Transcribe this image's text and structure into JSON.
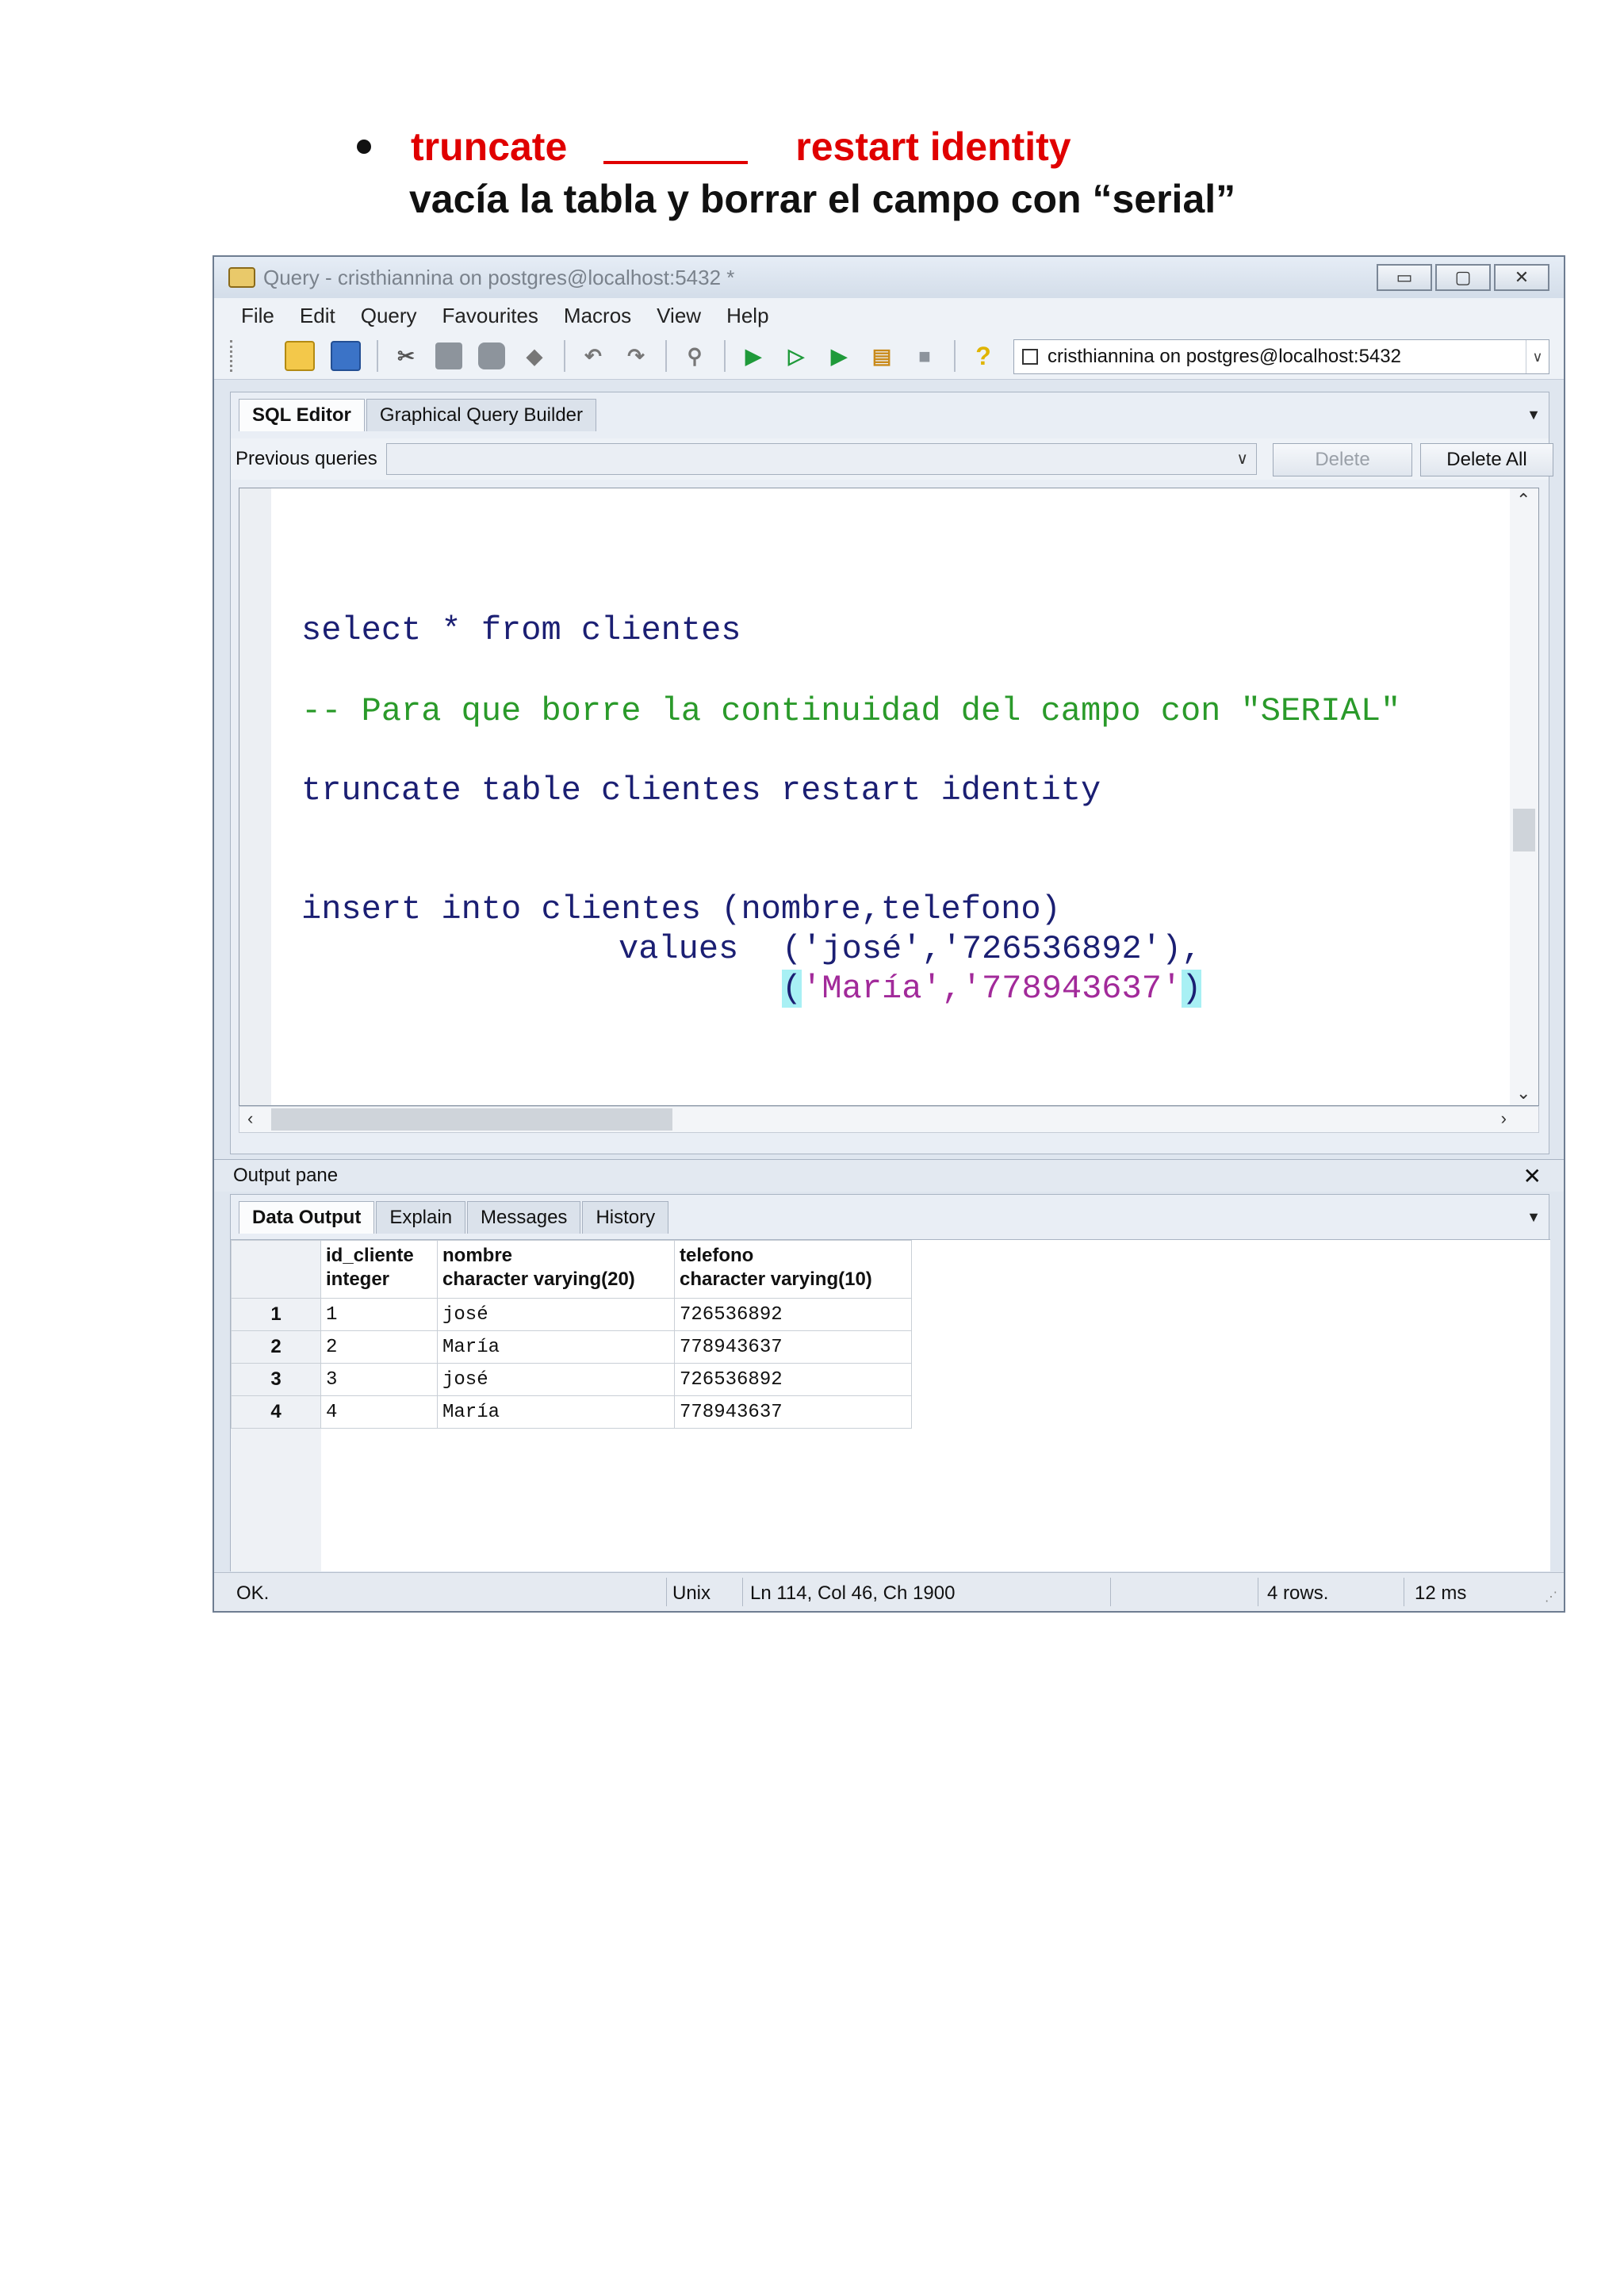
{
  "heading": {
    "keyword1": "truncate",
    "keyword2": "restart identity",
    "description": "vacía la tabla y borrar el campo con “serial”"
  },
  "window": {
    "title": "Query - cristhiannina on postgres@localhost:5432 *",
    "controls": {
      "minimize": "▭",
      "maximize": "▢",
      "close": "✕"
    }
  },
  "menu": [
    "File",
    "Edit",
    "Query",
    "Favourites",
    "Macros",
    "View",
    "Help"
  ],
  "toolbar": {
    "icons": [
      "open-file-icon",
      "save-icon",
      "cut-icon",
      "copy-icon",
      "paste-icon",
      "clear-icon",
      "undo-icon",
      "redo-icon",
      "find-icon",
      "execute-icon",
      "explain-icon",
      "execute-to-file-icon",
      "explain-analyze-icon",
      "stop-icon",
      "help-icon"
    ],
    "connection": "cristhiannina on postgres@localhost:5432"
  },
  "editor": {
    "tabs": [
      "SQL Editor",
      "Graphical Query Builder"
    ],
    "previous_queries_label": "Previous queries",
    "previous_queries_value": "",
    "delete_label": "Delete",
    "delete_all_label": "Delete All",
    "code": {
      "line1": "select * from clientes",
      "line2": "-- Para que borre la continuidad del campo con \"SERIAL\"",
      "line3": "truncate table clientes restart identity",
      "line4": "insert into clientes (nombre,telefono)",
      "line5_kw": "values",
      "line5_val": "('josé','726536892'),",
      "line6_open": "(",
      "line6_val": "'María','778943637'",
      "line6_close": ")"
    }
  },
  "output": {
    "title": "Output pane",
    "tabs": [
      "Data Output",
      "Explain",
      "Messages",
      "History"
    ],
    "columns": [
      {
        "name": "id_cliente",
        "type": "integer"
      },
      {
        "name": "nombre",
        "type": "character varying(20)"
      },
      {
        "name": "telefono",
        "type": "character varying(10)"
      }
    ],
    "rows": [
      {
        "n": "1",
        "id": "1",
        "nombre": "josé",
        "telefono": "726536892"
      },
      {
        "n": "2",
        "id": "2",
        "nombre": "María",
        "telefono": "778943637"
      },
      {
        "n": "3",
        "id": "3",
        "nombre": "josé",
        "telefono": "726536892"
      },
      {
        "n": "4",
        "id": "4",
        "nombre": "María",
        "telefono": "778943637"
      }
    ]
  },
  "status": {
    "message": "OK.",
    "line_endings": "Unix",
    "position": "Ln 114, Col 46, Ch 1900",
    "rows": "4 rows.",
    "time": "12 ms"
  }
}
